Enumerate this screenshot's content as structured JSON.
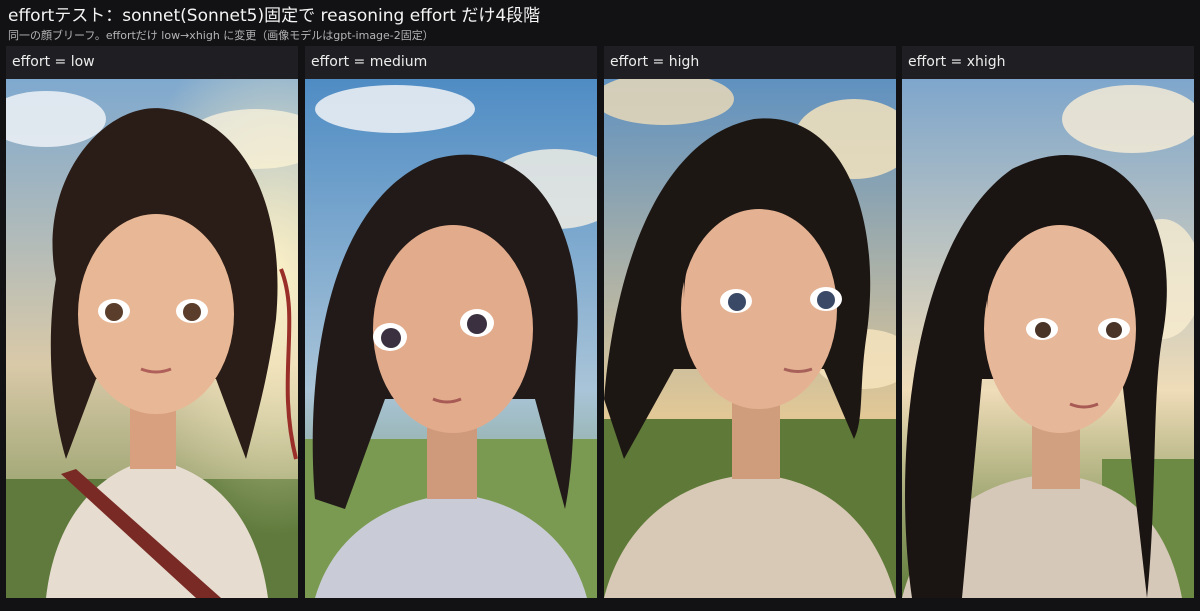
{
  "header": {
    "title": "effortテスト：sonnet(Sonnet5)固定で reasoning effort だけ4段階",
    "subtitle": "同一の顔ブリーフ。effortだけ low→xhigh に変更（画像モデルはgpt-image-2固定）"
  },
  "panels": [
    {
      "label": "effort = low",
      "image_subject": "anime-style portrait of a young woman with dark hair and a red ribbon, backlit by golden sunlight",
      "colors": {
        "sky": "#8fb8d6",
        "hair": "#2a1c16",
        "skin": "#e8b896",
        "shirt": "#e6dcd0",
        "strap": "#7a2a24"
      }
    },
    {
      "label": "effort = medium",
      "image_subject": "anime-style portrait of a young woman with dark shoulder-length hair against a blue sky",
      "colors": {
        "sky": "#5e96c8",
        "hair": "#211a18",
        "skin": "#e2ab8c",
        "shirt": "#c9ccd6",
        "strap": ""
      }
    },
    {
      "label": "effort = high",
      "image_subject": "anime-style portrait of a young woman with windswept dark hair in a sunlit field",
      "colors": {
        "sky": "#6d9cc4",
        "hair": "#1d1714",
        "skin": "#e4b292",
        "shirt": "#d8c9b6",
        "strap": ""
      }
    },
    {
      "label": "effort = xhigh",
      "image_subject": "anime-style portrait of a young woman with long dark hair in a meadow at golden hour",
      "colors": {
        "sky": "#8aaed0",
        "hair": "#1a1412",
        "skin": "#e6b798",
        "shirt": "#d6c8b8",
        "strap": ""
      }
    }
  ]
}
